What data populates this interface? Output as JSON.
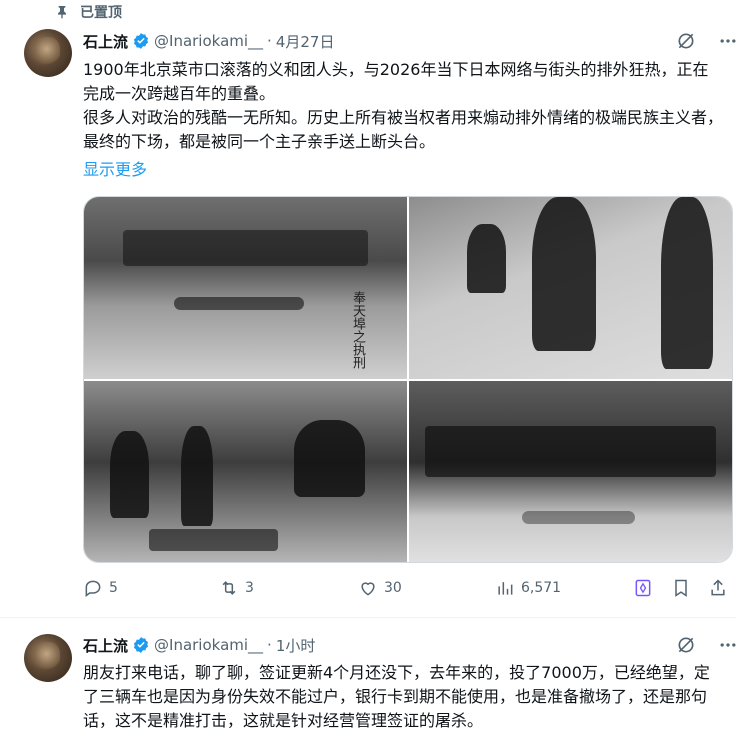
{
  "pinned": {
    "label": "已置顶"
  },
  "tweets": [
    {
      "name": "石上流",
      "handle": "@Inariokami__",
      "dot": "·",
      "time": "4月27日",
      "text": "1900年北京菜市口滚落的义和团人头，与2026年当下日本网络与街头的排外狂热，正在完成一次跨越百年的重叠。\n很多人对政治的残酷一无所知。历史上所有被当权者用来煽动排外情绪的极端民族主义者，最终的下场，都是被同一个主子亲手送上断头台。",
      "show_more": "显示更多",
      "image_caption": "奉天埠之执刑",
      "stats": {
        "replies": "5",
        "reposts": "3",
        "likes": "30",
        "views": "6,571"
      }
    },
    {
      "name": "石上流",
      "handle": "@Inariokami__",
      "dot": "·",
      "time": "1小时",
      "text": "朋友打来电话，聊了聊，签证更新4个月还没下，去年来的，投了7000万，已经绝望，定了三辆车也是因为身份失效不能过户，银行卡到期不能使用，也是准备撤场了，还是那句话，这不是精准打击，这就是针对经营管理签证的屠杀。"
    }
  ],
  "colors": {
    "accent": "#1d9bf0",
    "muted": "#536471",
    "text": "#0f1419",
    "grok_purple": "#7856ff"
  }
}
